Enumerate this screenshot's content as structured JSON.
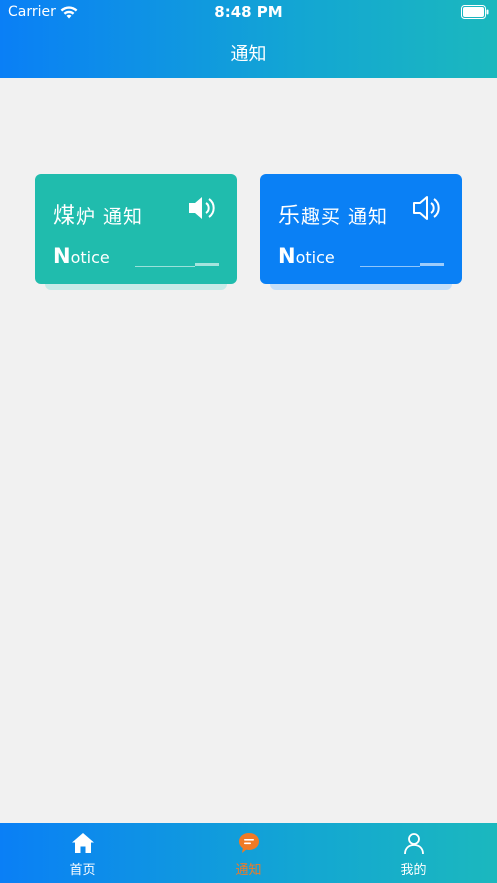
{
  "status_bar": {
    "carrier": "Carrier",
    "time": "8:48 PM"
  },
  "nav": {
    "title": "通知"
  },
  "cards": [
    {
      "title_big": "煤",
      "title_rest": "炉 通知",
      "notice_first": "N",
      "notice_rest": "otice",
      "color": "#20bcad",
      "icon": "speaker-icon"
    },
    {
      "title_big": "乐",
      "title_rest": "趣买 通知",
      "notice_first": "N",
      "notice_rest": "otice",
      "color": "#0a80f5",
      "icon": "speaker-icon"
    }
  ],
  "tabbar": {
    "items": [
      {
        "label": "首页",
        "icon": "home-icon",
        "active": false
      },
      {
        "label": "通知",
        "icon": "message-icon",
        "active": true
      },
      {
        "label": "我的",
        "icon": "user-icon",
        "active": false
      }
    ],
    "active_color": "#f07a25"
  }
}
